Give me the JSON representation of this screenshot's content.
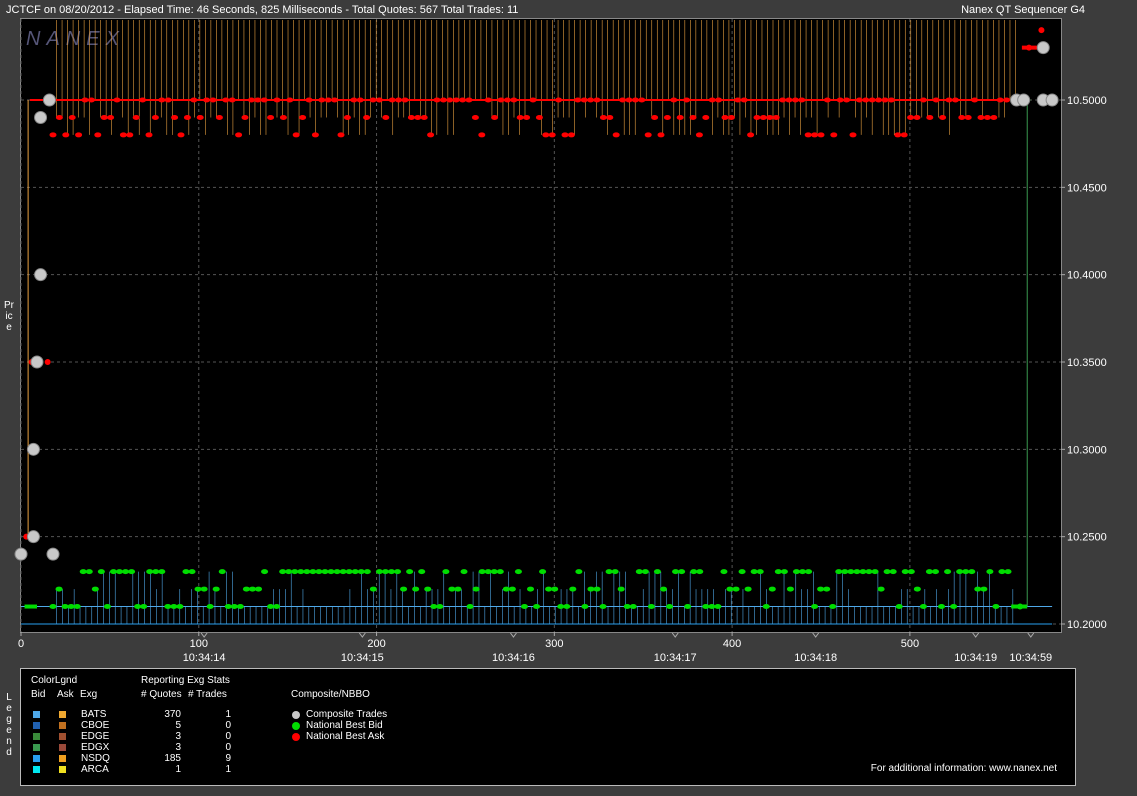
{
  "header": {
    "left": "JCTCF on 08/20/2012  -  Elapsed Time: 46 Seconds, 825 Milliseconds  -  Total Quotes: 567  Total Trades: 11",
    "right": "Nanex QT Sequencer G4"
  },
  "watermark": "NANEX",
  "axis": {
    "ylabel": "Price",
    "y_ticks": [
      "10.2000",
      "10.2500",
      "10.3000",
      "10.3500",
      "10.4000",
      "10.4500",
      "10.5000"
    ],
    "x_num_ticks": [
      "0",
      "100",
      "200",
      "300",
      "400",
      "500"
    ],
    "x_time_ticks": [
      "10:34:14",
      "10:34:15",
      "10:34:16",
      "10:34:17",
      "10:34:18",
      "10:34:19",
      "10:34:59"
    ]
  },
  "chart_data": {
    "type": "scatter",
    "title": "JCTCF on 08/20/2012",
    "ylabel": "Price",
    "xlabel": "",
    "ylim": [
      10.2,
      10.53
    ],
    "xlim": [
      0,
      585
    ],
    "y_ticks": [
      10.2,
      10.25,
      10.3,
      10.35,
      10.4,
      10.45,
      10.5
    ],
    "x_ticks": [
      0,
      100,
      200,
      300,
      400,
      500
    ],
    "time_ticks": [
      {
        "x": 103,
        "label": "10:34:14"
      },
      {
        "x": 192,
        "label": "10:34:15"
      },
      {
        "x": 277,
        "label": "10:34:16"
      },
      {
        "x": 368,
        "label": "10:34:17"
      },
      {
        "x": 447,
        "label": "10:34:18"
      },
      {
        "x": 537,
        "label": "10:34:19"
      },
      {
        "x": 568,
        "label": "10:34:59"
      }
    ],
    "grid": true,
    "series": [
      {
        "name": "Composite Trades",
        "color": "#c8c8c8",
        "points": [
          [
            0,
            10.24
          ],
          [
            7,
            10.25
          ],
          [
            7,
            10.3
          ],
          [
            9,
            10.35
          ],
          [
            11,
            10.4
          ],
          [
            11,
            10.49
          ],
          [
            16,
            10.5
          ],
          [
            18,
            10.24
          ],
          [
            560,
            10.5
          ],
          [
            564,
            10.5
          ],
          [
            575,
            10.5
          ],
          [
            580,
            10.5
          ],
          [
            575,
            10.53
          ]
        ]
      },
      {
        "name": "National Best Bid",
        "color": "#00ff00",
        "ask_levels": [
          10.21,
          10.22,
          10.23
        ],
        "last_points": [
          [
            566,
            10.5
          ],
          [
            562,
            10.21
          ]
        ]
      },
      {
        "name": "National Best Ask",
        "color": "#ff0000",
        "levels": [
          10.48,
          10.49,
          10.5
        ],
        "first_points": [
          [
            3,
            10.25
          ],
          [
            5,
            10.3
          ],
          [
            6,
            10.35
          ],
          [
            15,
            10.35
          ]
        ],
        "last_points": [
          [
            567,
            10.53
          ],
          [
            574,
            10.54
          ]
        ]
      }
    ]
  },
  "legend": {
    "side_label": "Legend",
    "colorlgnd": "ColorLgnd",
    "bid": "Bid",
    "ask": "Ask",
    "exg": "Exg",
    "stats_title": "Reporting Exg Stats",
    "quotes_header": "# Quotes",
    "trades_header": "# Trades",
    "composite_title": "Composite/NBBO",
    "exchanges": [
      {
        "name": "BATS",
        "quotes": "370",
        "trades": "1",
        "bid": "#4fa8e8",
        "ask": "#f0a830"
      },
      {
        "name": "CBOE",
        "quotes": "5",
        "trades": "0",
        "bid": "#2060b0",
        "ask": "#c07020"
      },
      {
        "name": "EDGE",
        "quotes": "3",
        "trades": "0",
        "bid": "#3a8a3a",
        "ask": "#a05030"
      },
      {
        "name": "EDGX",
        "quotes": "3",
        "trades": "0",
        "bid": "#3a9a50",
        "ask": "#9a4a3a"
      },
      {
        "name": "NSDQ",
        "quotes": "185",
        "trades": "9",
        "bid": "#28a0f0",
        "ask": "#f0a020"
      },
      {
        "name": "ARCA",
        "quotes": "1",
        "trades": "1",
        "bid": "#00e8f0",
        "ask": "#f0e020"
      }
    ],
    "composite": [
      {
        "label": "Composite Trades",
        "color": "#c8c8c8"
      },
      {
        "label": "National Best Bid",
        "color": "#00dd00"
      },
      {
        "label": "National Best Ask",
        "color": "#ff0000"
      }
    ],
    "footer": "For additional information: www.nanex.net"
  }
}
